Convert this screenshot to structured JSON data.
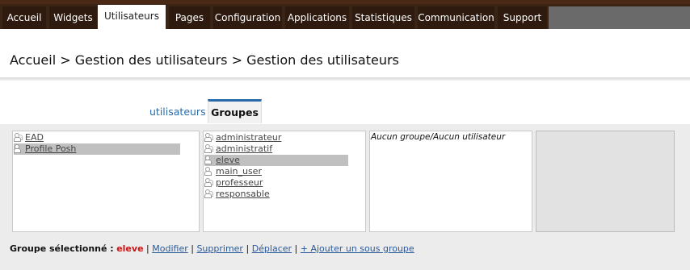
{
  "nav": {
    "tabs": [
      {
        "label": "Accueil",
        "active": false
      },
      {
        "label": "Widgets",
        "active": false
      },
      {
        "label": "Utilisateurs",
        "active": true
      },
      {
        "label": "Pages",
        "active": false
      },
      {
        "label": "Configuration",
        "active": false
      },
      {
        "label": "Applications",
        "active": false
      },
      {
        "label": "Statistiques",
        "active": false
      },
      {
        "label": "Communication",
        "active": false
      },
      {
        "label": "Support",
        "active": false
      }
    ]
  },
  "breadcrumb": "Accueil > Gestion des utilisateurs > Gestion des utilisateurs",
  "subtabs": {
    "users": "utilisateurs",
    "groups": "Groupes"
  },
  "columns": {
    "col1": {
      "items": [
        {
          "label": "EAD",
          "selected": false
        },
        {
          "label": "Profile Posh",
          "selected": true
        }
      ]
    },
    "col2": {
      "items": [
        {
          "label": "administrateur",
          "selected": false
        },
        {
          "label": "administratif",
          "selected": false
        },
        {
          "label": "eleve",
          "selected": true
        },
        {
          "label": "main_user",
          "selected": false
        },
        {
          "label": "professeur",
          "selected": false
        },
        {
          "label": "responsable",
          "selected": false
        }
      ]
    },
    "col3": {
      "empty_message": "Aucun groupe/Aucun utilisateur"
    }
  },
  "actions": {
    "selected_label": "Groupe sélectionné :",
    "selected_name": "eleve",
    "separator": "|",
    "modify": "Modifier",
    "delete": "Supprimer",
    "move": "Déplacer",
    "add_subgroup": "+ Ajouter un sous groupe"
  },
  "colors": {
    "nav_bg": "#2e1a0e",
    "link": "#2a6aa8",
    "selected_name": "#d01010",
    "selection_bg": "#c0c0c0"
  }
}
